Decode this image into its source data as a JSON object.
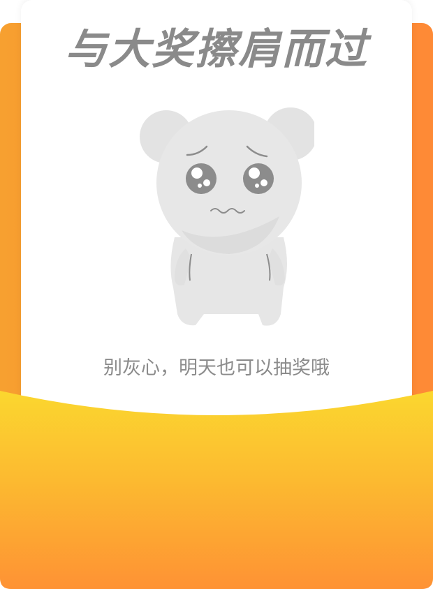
{
  "dialog": {
    "title": "与大奖擦肩而过",
    "message": "别灰心，明天也可以抽奖哦",
    "illustration": "sad-bear-icon"
  },
  "colors": {
    "envelope_top": "#fbd72f",
    "envelope_bottom": "#fe9234",
    "envelope_back": "#fb8e2e",
    "title_text": "#8a8a8a",
    "message_text": "#8b8b8b",
    "bear_fill": "#e6e6e6",
    "bear_features": "#8c8c8c"
  }
}
